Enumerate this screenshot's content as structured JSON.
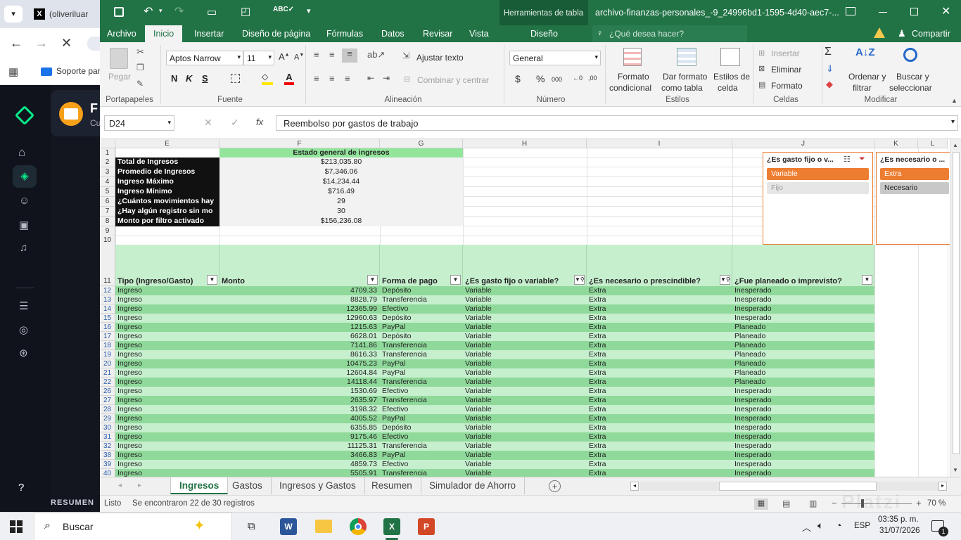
{
  "browser": {
    "tab_label": "(oliveriluar",
    "bookmark_label": "Soporte par"
  },
  "platzi": {
    "course_initial": "F",
    "course_sub": "Cu",
    "section_label": "RESUMEN"
  },
  "excel": {
    "quick_more": "▾",
    "table_tools": "Herramientas de tabla",
    "title": "archivo-finanzas-personales_-9_24996bd1-1595-4d40-aec7-...",
    "menu_tabs": [
      "Archivo",
      "Inicio",
      "Insertar",
      "Diseño de página",
      "Fórmulas",
      "Datos",
      "Revisar",
      "Vista"
    ],
    "design_tab": "Diseño",
    "tell_me": "¿Qué desea hacer?",
    "share": "Compartir",
    "ribbon": {
      "paste": "Pegar",
      "font_name": "Aptos Narrow",
      "font_size": "11",
      "wrap_text": "Ajustar texto",
      "merge_center": "Combinar y centrar",
      "number_format": "General",
      "conditional_format": [
        "Formato",
        "condicional"
      ],
      "format_as_table": [
        "Dar formato",
        "como tabla"
      ],
      "cell_styles": [
        "Estilos de",
        "celda"
      ],
      "insert": "Insertar",
      "delete": "Eliminar",
      "format": "Formato",
      "sort_filter": [
        "Ordenar y",
        "filtrar"
      ],
      "find_select": [
        "Buscar y",
        "seleccionar"
      ],
      "groups": [
        "Portapapeles",
        "Fuente",
        "Alineación",
        "Número",
        "Estilos",
        "Celdas",
        "Modificar"
      ],
      "bold": "N",
      "italic": "K",
      "underline": "S"
    },
    "name_box": "D24",
    "formula_fx": "fx",
    "formula_value": "Reembolso por gastos de trabajo",
    "columns": [
      "E",
      "F",
      "G",
      "H",
      "I",
      "J",
      "K",
      "L"
    ],
    "summary": {
      "header": "Estado general de ingresos",
      "rows": [
        {
          "label": "Total de Ingresos",
          "value": "$213,035.80"
        },
        {
          "label": "Promedio de Ingresos",
          "value": "$7,346.06"
        },
        {
          "label": "Ingreso Máximo",
          "value": "$14,234.44"
        },
        {
          "label": "Ingreso Mínimo",
          "value": "$716.49"
        },
        {
          "label": "¿Cuántos movimientos hay",
          "value": "29"
        },
        {
          "label": "¿Hay algún registro sin mo",
          "value": "30"
        },
        {
          "label": "Monto por filtro activado",
          "value": "$156,236.08"
        }
      ]
    },
    "table_headers": [
      "Tipo (Ingreso/Gasto)",
      "Monto",
      "Forma de pago",
      "¿Es gasto fijo o variable?",
      "¿Es necesario o prescindible?",
      "¿Fue planeado o imprevisto?"
    ],
    "top_rows": [
      "1",
      "2",
      "3",
      "4",
      "5",
      "6",
      "7",
      "8",
      "9",
      "10",
      "11"
    ],
    "table_rows": [
      {
        "row": "12",
        "tipo": "Ingreso",
        "monto": "4709.33",
        "forma": "Depósito",
        "fijo": "Variable",
        "nec": "Extra",
        "plan": "Inesperado"
      },
      {
        "row": "13",
        "tipo": "Ingreso",
        "monto": "8828.79",
        "forma": "Transferencia",
        "fijo": "Variable",
        "nec": "Extra",
        "plan": "Inesperado"
      },
      {
        "row": "14",
        "tipo": "Ingreso",
        "monto": "12365.99",
        "forma": "Efectivo",
        "fijo": "Variable",
        "nec": "Extra",
        "plan": "Inesperado"
      },
      {
        "row": "15",
        "tipo": "Ingreso",
        "monto": "12960.63",
        "forma": "Depósito",
        "fijo": "Variable",
        "nec": "Extra",
        "plan": "Inesperado"
      },
      {
        "row": "16",
        "tipo": "Ingreso",
        "monto": "1215.63",
        "forma": "PayPal",
        "fijo": "Variable",
        "nec": "Extra",
        "plan": "Planeado"
      },
      {
        "row": "17",
        "tipo": "Ingreso",
        "monto": "6628.01",
        "forma": "Depósito",
        "fijo": "Variable",
        "nec": "Extra",
        "plan": "Planeado"
      },
      {
        "row": "18",
        "tipo": "Ingreso",
        "monto": "7141.86",
        "forma": "Transferencia",
        "fijo": "Variable",
        "nec": "Extra",
        "plan": "Planeado"
      },
      {
        "row": "19",
        "tipo": "Ingreso",
        "monto": "8616.33",
        "forma": "Transferencia",
        "fijo": "Variable",
        "nec": "Extra",
        "plan": "Planeado"
      },
      {
        "row": "20",
        "tipo": "Ingreso",
        "monto": "10475.23",
        "forma": "PayPal",
        "fijo": "Variable",
        "nec": "Extra",
        "plan": "Planeado"
      },
      {
        "row": "21",
        "tipo": "Ingreso",
        "monto": "12604.84",
        "forma": "PayPal",
        "fijo": "Variable",
        "nec": "Extra",
        "plan": "Planeado"
      },
      {
        "row": "22",
        "tipo": "Ingreso",
        "monto": "14118.44",
        "forma": "Transferencia",
        "fijo": "Variable",
        "nec": "Extra",
        "plan": "Planeado"
      },
      {
        "row": "26",
        "tipo": "Ingreso",
        "monto": "1530.69",
        "forma": "Efectivo",
        "fijo": "Variable",
        "nec": "Extra",
        "plan": "Inesperado"
      },
      {
        "row": "27",
        "tipo": "Ingreso",
        "monto": "2635.97",
        "forma": "Transferencia",
        "fijo": "Variable",
        "nec": "Extra",
        "plan": "Inesperado"
      },
      {
        "row": "28",
        "tipo": "Ingreso",
        "monto": "3198.32",
        "forma": "Efectivo",
        "fijo": "Variable",
        "nec": "Extra",
        "plan": "Inesperado"
      },
      {
        "row": "29",
        "tipo": "Ingreso",
        "monto": "4005.52",
        "forma": "PayPal",
        "fijo": "Variable",
        "nec": "Extra",
        "plan": "Inesperado"
      },
      {
        "row": "30",
        "tipo": "Ingreso",
        "monto": "6355.85",
        "forma": "Depósito",
        "fijo": "Variable",
        "nec": "Extra",
        "plan": "Inesperado"
      },
      {
        "row": "31",
        "tipo": "Ingreso",
        "monto": "9175.46",
        "forma": "Efectivo",
        "fijo": "Variable",
        "nec": "Extra",
        "plan": "Inesperado"
      },
      {
        "row": "32",
        "tipo": "Ingreso",
        "monto": "11125.31",
        "forma": "Transferencia",
        "fijo": "Variable",
        "nec": "Extra",
        "plan": "Inesperado"
      },
      {
        "row": "38",
        "tipo": "Ingreso",
        "monto": "3466.83",
        "forma": "PayPal",
        "fijo": "Variable",
        "nec": "Extra",
        "plan": "Inesperado"
      },
      {
        "row": "39",
        "tipo": "Ingreso",
        "monto": "4859.73",
        "forma": "Efectivo",
        "fijo": "Variable",
        "nec": "Extra",
        "plan": "Inesperado"
      },
      {
        "row": "40",
        "tipo": "Ingreso",
        "monto": "5505.91",
        "forma": "Transferencia",
        "fijo": "Variable",
        "nec": "Extra",
        "plan": "Inesperado"
      }
    ],
    "slicer1": {
      "title": "¿Es gasto fijo o v...",
      "items": [
        "Variable",
        "Fijo"
      ]
    },
    "slicer2": {
      "title": "¿Es necesario o ...",
      "items": [
        "Extra",
        "Necesario"
      ]
    },
    "sheet_tabs": [
      "Ingresos",
      "Gastos",
      "Ingresos y Gastos",
      "Resumen",
      "Simulador de Ahorro"
    ],
    "status_ready": "Listo",
    "status_msg": "Se encontraron 22 de 30 registros",
    "zoom": "70 %"
  },
  "taskbar": {
    "search": "Buscar",
    "lang": "ESP",
    "time": "03:35 p. m.",
    "date": "31/07/2026",
    "notif_count": "1"
  },
  "colors": {
    "excel_green": "#217346",
    "table_dark": "#8fd99a",
    "table_light": "#c6efce",
    "slicer_sel": "#ed7d31",
    "header_green": "#92e59b"
  }
}
